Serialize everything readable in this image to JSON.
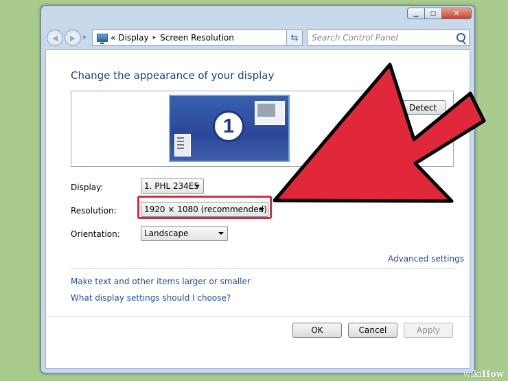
{
  "window": {
    "controls": {
      "minimize": "▁",
      "maximize": "▢",
      "close": "✕"
    }
  },
  "address": {
    "chevrons": "«",
    "crumbs": [
      "Display",
      "Screen Resolution"
    ],
    "separator": "▸",
    "icon": "monitor-icon"
  },
  "search": {
    "placeholder": "Search Control Panel"
  },
  "main": {
    "heading": "Change the appearance of your display",
    "detect_label": "Detect",
    "monitor_number": "1",
    "display_label": "Display:",
    "display_value": "1. PHL 234E5",
    "resolution_label": "Resolution:",
    "resolution_value": "1920 × 1080 (recommended)",
    "orientation_label": "Orientation:",
    "orientation_value": "Landscape",
    "advanced_link": "Advanced settings",
    "link_text_size": "Make text and other items larger or smaller",
    "link_help": "What display settings should I choose?"
  },
  "footer": {
    "ok": "OK",
    "cancel": "Cancel",
    "apply": "Apply"
  },
  "annotation": {
    "arrow_color": "#e0283a",
    "highlight_color": "#cf2f3f"
  },
  "watermark": {
    "part1": "wiki",
    "part2": "How"
  }
}
